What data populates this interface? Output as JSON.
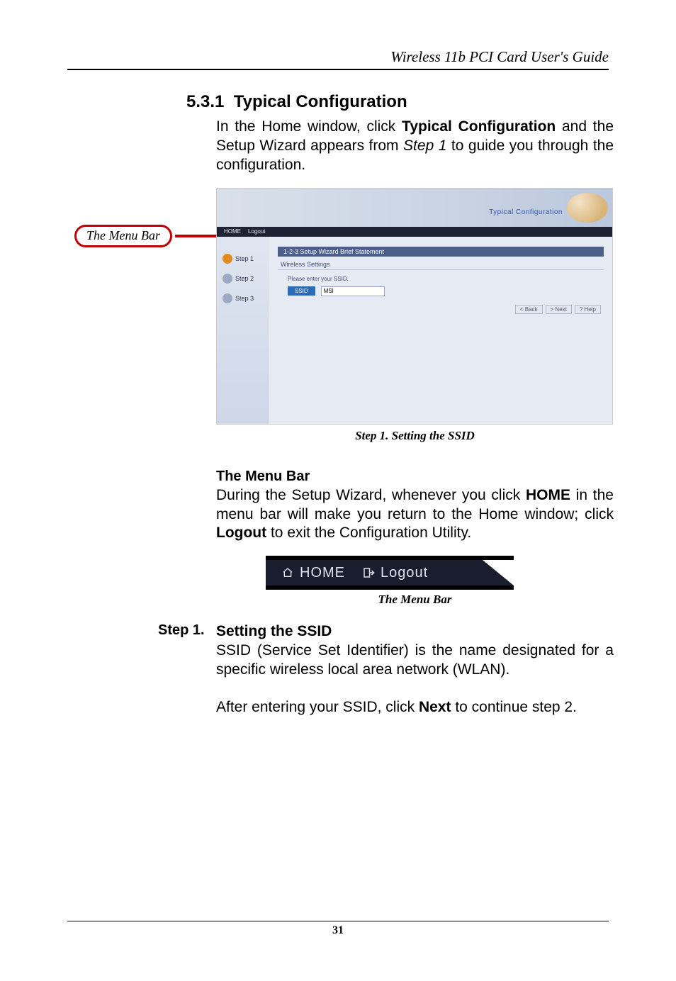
{
  "header": {
    "running_title": "Wireless 11b PCI Card User's Guide"
  },
  "section": {
    "number": "5.3.1",
    "title": "Typical Configuration",
    "intro_pre": "In the Home window, click ",
    "intro_bold": "Typical Configuration",
    "intro_mid": " and the Setup Wizard appears from ",
    "intro_ital": "Step 1",
    "intro_post": " to guide you through the configuration."
  },
  "callout": {
    "menu_bar_label": "The Menu Bar"
  },
  "screenshot": {
    "banner_title": "Typical Configuration",
    "menu_home": "HOME",
    "menu_logout": "Logout",
    "steps": [
      "Step 1",
      "Step 2",
      "Step 3"
    ],
    "panel_title": "1-2-3 Setup Wizard Brief Statement",
    "subpanel_title": "Wireless Settings",
    "field_prompt": "Please enter your SSID.",
    "ssid_badge": "SSID",
    "ssid_value": "MSI",
    "btn_back": "< Back",
    "btn_next": "> Next",
    "btn_help": "? Help"
  },
  "fig1_caption": "Step 1. Setting the SSID",
  "menu_bar_section": {
    "heading": "The Menu Bar",
    "text_pre": "During the Setup Wizard, whenever you click ",
    "text_bold1": "HOME",
    "text_mid": " in the menu bar will make you return to the Home window; click ",
    "text_bold2": "Logout",
    "text_post": " to exit the Configuration Utility."
  },
  "menubar_img": {
    "home": "HOME",
    "logout": "Logout"
  },
  "fig2_caption": "The Menu Bar",
  "step1": {
    "label": "Step 1.",
    "heading": "Setting the SSID",
    "p1": "SSID (Service Set Identifier) is the name designated for a specific wireless local area network (WLAN).",
    "p2_pre": "After entering your SSID, click ",
    "p2_ital": "Next",
    "p2_mid": " to continue ",
    "p2_ital2": "step 2",
    "p2_post": "."
  },
  "footer": {
    "page_number": "31"
  }
}
